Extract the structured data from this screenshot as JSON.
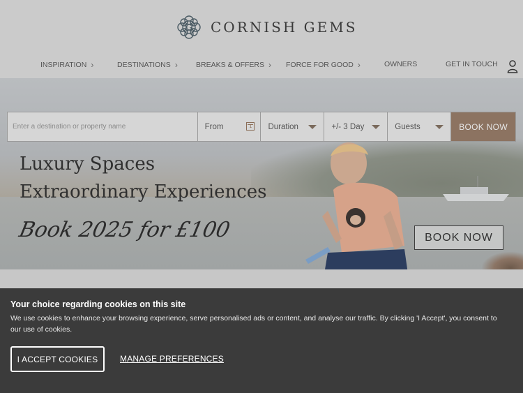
{
  "brand": {
    "name": "CORNISH GEMS",
    "logo_icon": "ornamental-knot-logo"
  },
  "nav": {
    "items": [
      {
        "label": "INSPIRATION",
        "has_chevron": true
      },
      {
        "label": "DESTINATIONS",
        "has_chevron": true
      },
      {
        "label": "BREAKS & OFFERS",
        "has_chevron": true
      },
      {
        "label": "FORCE FOR GOOD",
        "has_chevron": true
      },
      {
        "label": "OWNERS",
        "has_chevron": false
      },
      {
        "label": "GET IN TOUCH",
        "has_chevron": false
      }
    ],
    "chevron": "›",
    "account_icon": "user-icon"
  },
  "search": {
    "destination_placeholder": "Enter a destination or property name",
    "from_label": "From",
    "calendar_day": "1",
    "duration_label": "Duration",
    "flex_label": "+/- 3 Day",
    "guests_label": "Guests",
    "book_label": "BOOK NOW"
  },
  "hero": {
    "line1": "Luxury Spaces",
    "line2": "Extraordinary Experiences",
    "script": "Book 2025 for £100",
    "book_label": "BOOK NOW"
  },
  "cookie": {
    "title": "Your choice regarding cookies on this site",
    "text": "We use cookies to enhance your browsing experience, serve personalised ads or content, and analyse our traffic. By clicking 'I Accept', you consent to our use of cookies.",
    "accept_label": "I ACCEPT COOKIES",
    "manage_label": "MANAGE PREFERENCES"
  },
  "colors": {
    "accent": "#8c7361",
    "banner": "#3b3b3b",
    "overlay_bg": "#c6c6c6"
  }
}
